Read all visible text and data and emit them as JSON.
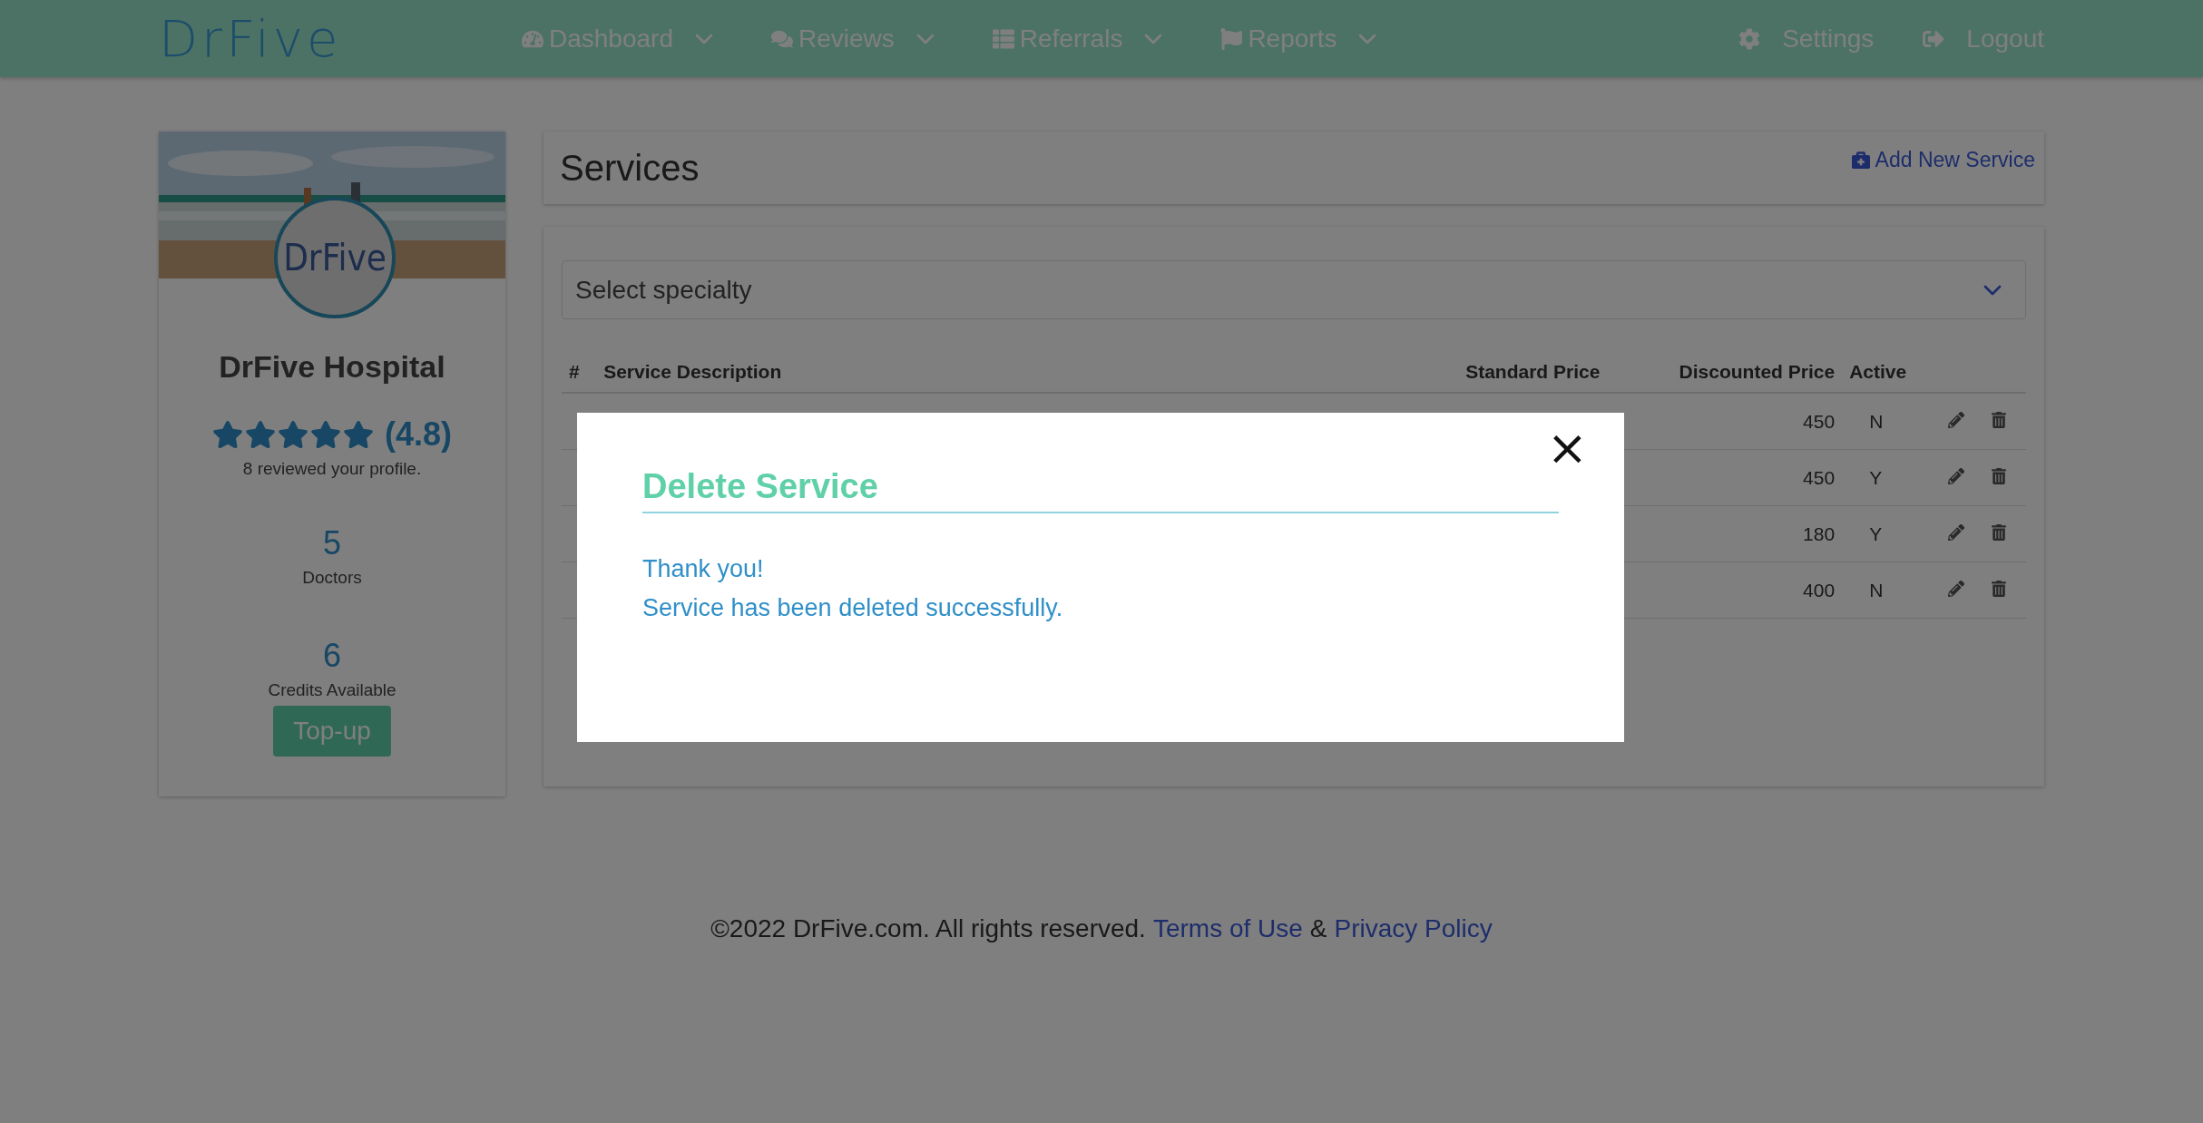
{
  "header": {
    "logo": "DrFive",
    "nav": [
      {
        "kind": "dashboard",
        "label": "Dashboard"
      },
      {
        "kind": "reviews",
        "label": "Reviews"
      },
      {
        "kind": "referrals",
        "label": "Referrals"
      },
      {
        "kind": "reports",
        "label": "Reports"
      }
    ],
    "actions": [
      {
        "kind": "settings",
        "label": "Settings"
      },
      {
        "kind": "logout",
        "label": "Logout"
      }
    ]
  },
  "profile": {
    "logo": "DrFive",
    "name": "DrFive Hospital",
    "stars": 5,
    "rating": "(4.8)",
    "reviews": "8 reviewed your profile.",
    "stats": [
      {
        "value": "5",
        "label": "Doctors"
      },
      {
        "value": "6",
        "label": "Credits Available"
      }
    ],
    "button": "Top-up"
  },
  "services": {
    "title": "Services",
    "add_link": "Add New Service",
    "select": {
      "placeholder": "Select specialty"
    },
    "table": {
      "columns": [
        "#",
        "Service Description",
        "Standard Price",
        "Discounted Price",
        "Active"
      ],
      "rows": [
        {
          "discounted": "450",
          "active": "N"
        },
        {
          "discounted": "450",
          "active": "Y"
        },
        {
          "discounted": "180",
          "active": "Y"
        },
        {
          "discounted": "400",
          "active": "N"
        }
      ]
    }
  },
  "footer": {
    "copyright": "©2022 DrFive.com. All rights reserved.",
    "terms": "Terms of Use",
    "separator": "&",
    "privacy": "Privacy Policy"
  },
  "modal": {
    "title": "Delete Service",
    "close": "×",
    "lines": [
      "Thank you!",
      "Service has been deleted successfully."
    ]
  }
}
